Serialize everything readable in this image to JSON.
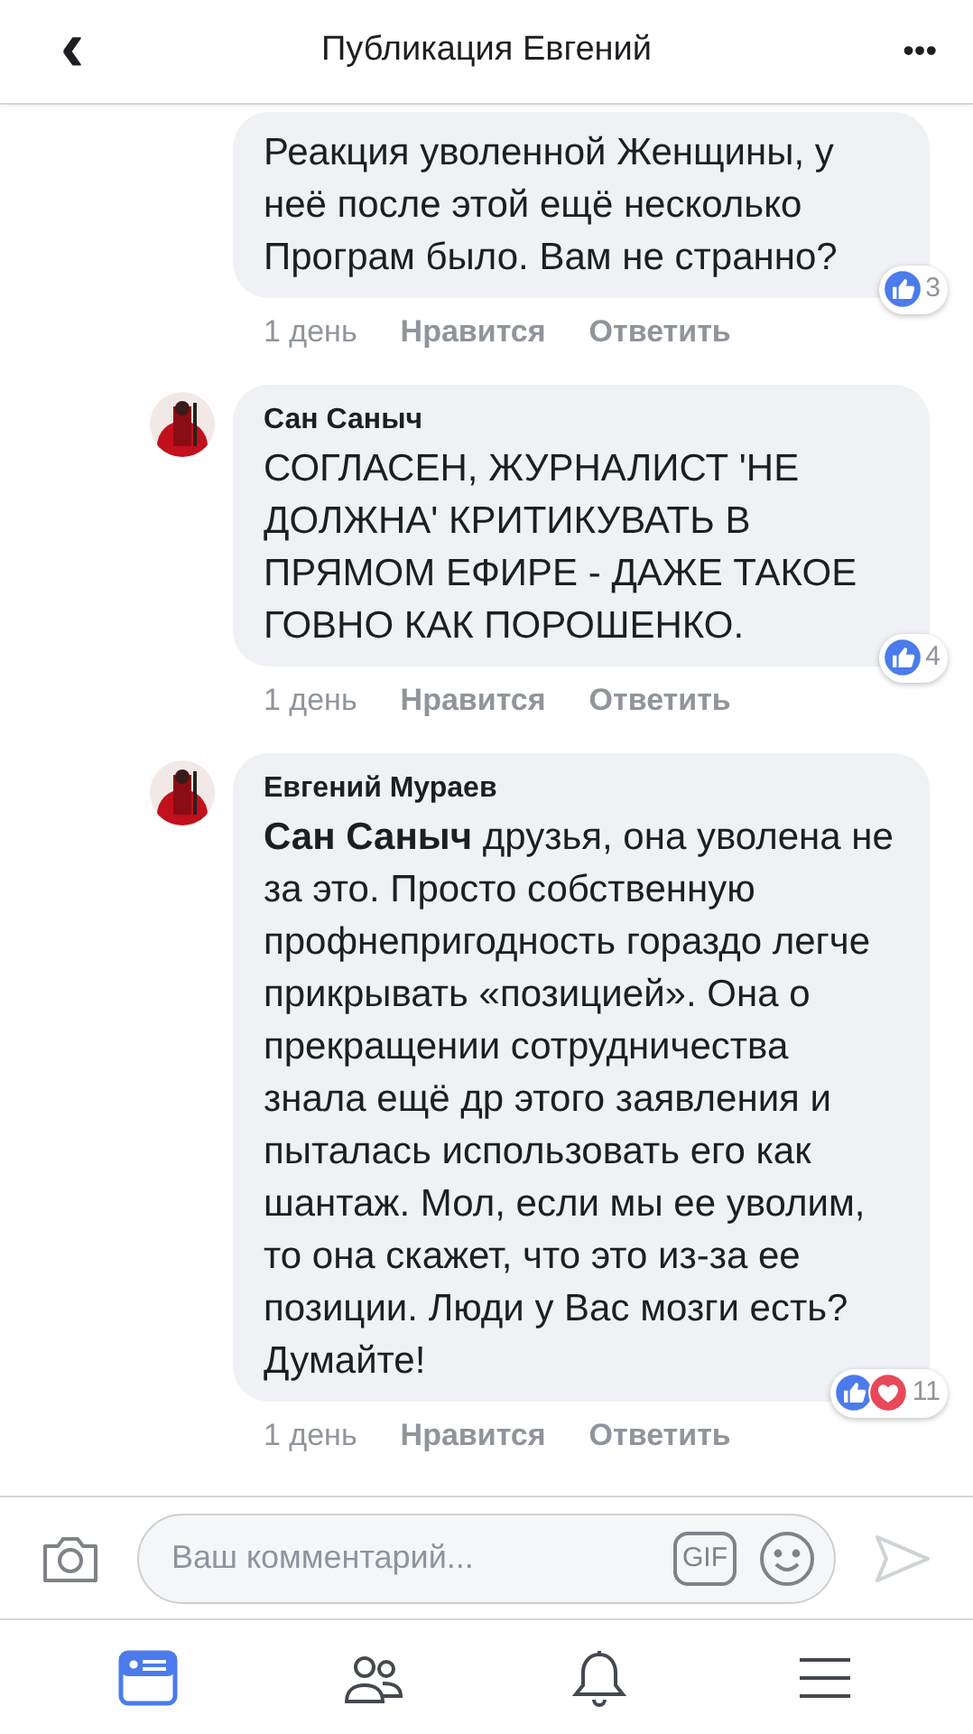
{
  "header": {
    "back": "‹",
    "title": "Публикация Евгений",
    "more": "•••"
  },
  "comments": [
    {
      "text": "Реакция уволенной Женщины, у неё после этой ещё несколько Програм было. Вам  не странно?",
      "time": "1 день",
      "like": "Нравится",
      "reply": "Ответить",
      "reactions": [
        {
          "kind": "like"
        }
      ],
      "count": "3"
    },
    {
      "author": "Сан Саныч",
      "text": "СОГЛАСЕН, ЖУРНАЛИСТ 'НЕ ДОЛЖНА' КРИТИКУВАТЬ В ПРЯМОМ ЕФИРЕ - ДАЖЕ ТАКОЕ ГОВНО КАК ПОРОШЕНКО.",
      "time": "1 день",
      "like": "Нравится",
      "reply": "Ответить",
      "reactions": [
        {
          "kind": "like"
        }
      ],
      "count": "4"
    },
    {
      "author": "Евгений Мураев",
      "text": "**Сан Саныч** друзья, она уволена не за это. Просто собственную профнепригодность гораздо легче прикрывать «позицией». Она о прекращении сотрудничества знала ещё др этого заявления и пыталась использовать его как шантаж. Мол, если мы ее уволим, то она скажет, что это из-за ее позиции. Люди у Вас мозги есть? Думайте!",
      "time": "1 день",
      "like": "Нравится",
      "reply": "Ответить",
      "reactions": [
        {
          "kind": "like"
        },
        {
          "kind": "love"
        }
      ],
      "count": "11"
    }
  ],
  "composer": {
    "placeholder": "Ваш комментарий...",
    "gif": "GIF"
  },
  "tabs": [
    {
      "kind": "feed",
      "selected": true
    },
    {
      "kind": "friends",
      "selected": false
    },
    {
      "kind": "notifications",
      "selected": false
    },
    {
      "kind": "menu",
      "selected": false
    }
  ]
}
